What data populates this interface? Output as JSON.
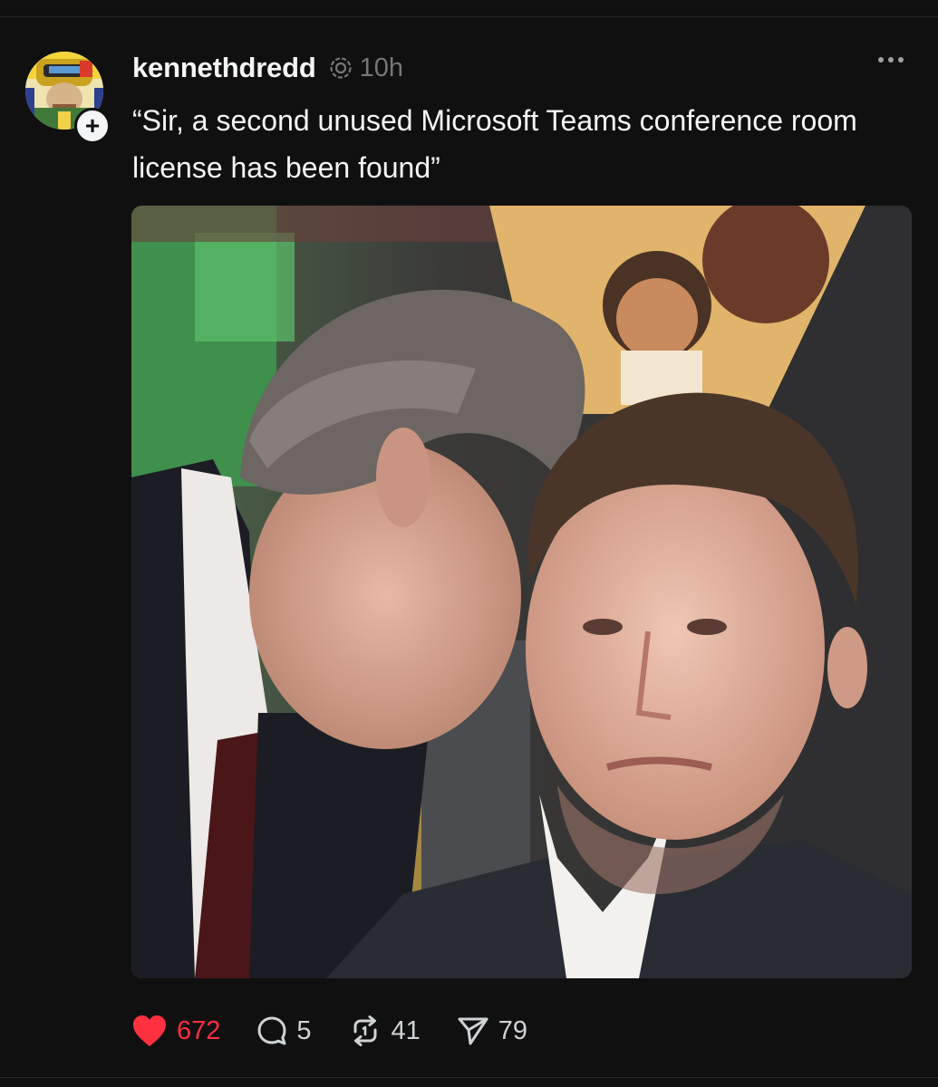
{
  "post": {
    "username": "kennethdredd",
    "timestamp": "10h",
    "caption": "“Sir, a second unused Microsoft Teams conference room license has been found”",
    "image_description_icon": "photo",
    "follow_badge": "+",
    "actions": {
      "likes": "672",
      "replies": "5",
      "reposts": "41",
      "shares": "79"
    },
    "colors": {
      "background": "#101010",
      "text": "#f3f5f7",
      "muted": "#777777",
      "like": "#ff3040"
    }
  }
}
